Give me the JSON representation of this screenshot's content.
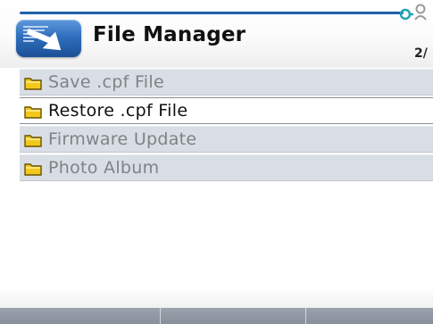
{
  "header": {
    "title": "File Manager",
    "page_indicator": "2/",
    "app_icon": "file-manager-arrow-icon",
    "status_icon": "network-status-icon"
  },
  "file_list": {
    "items": [
      {
        "label": "Save .cpf File",
        "icon": "folder-icon",
        "selected": false
      },
      {
        "label": "Restore .cpf File",
        "icon": "folder-icon",
        "selected": true
      },
      {
        "label": "Firmware Update",
        "icon": "folder-icon",
        "selected": false
      },
      {
        "label": "Photo Album",
        "icon": "folder-icon",
        "selected": false
      }
    ]
  },
  "softkeys": [
    {
      "label": ""
    },
    {
      "label": ""
    },
    {
      "label": ""
    }
  ],
  "colors": {
    "accent_blue": "#1f60a8",
    "list_item_bg": "#d9dee5",
    "selected_item_bg": "#ffffff",
    "folder_yellow": "#f3c81c",
    "softkey_bar": "#8f98a3"
  }
}
